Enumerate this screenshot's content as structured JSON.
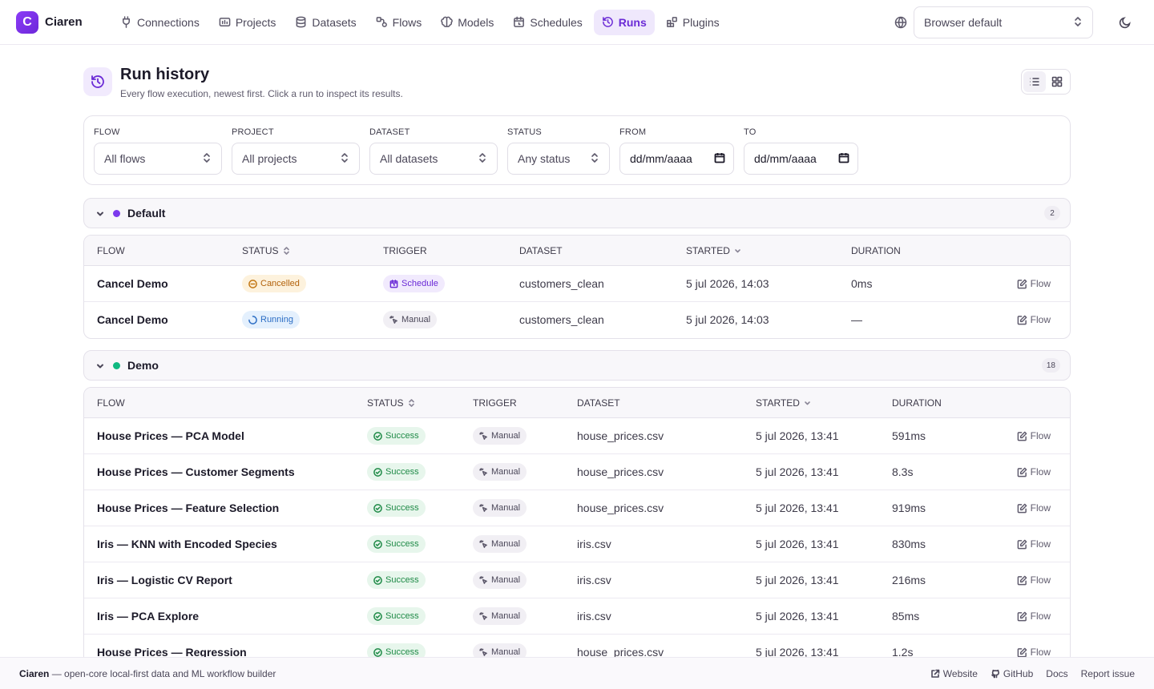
{
  "brand": {
    "logo_letter": "C",
    "name": "Ciaren"
  },
  "nav": [
    {
      "label": "Connections",
      "icon": "plug-icon"
    },
    {
      "label": "Projects",
      "icon": "folder-icon"
    },
    {
      "label": "Datasets",
      "icon": "database-icon"
    },
    {
      "label": "Flows",
      "icon": "flow-icon"
    },
    {
      "label": "Models",
      "icon": "brain-icon"
    },
    {
      "label": "Schedules",
      "icon": "calendar-icon"
    },
    {
      "label": "Runs",
      "icon": "history-icon",
      "active": true
    },
    {
      "label": "Plugins",
      "icon": "blocks-icon"
    }
  ],
  "language_select": {
    "value": "Browser default"
  },
  "header": {
    "title": "Run history",
    "subtitle": "Every flow execution, newest first. Click a run to inspect its results."
  },
  "filters": {
    "flow": {
      "label": "Flow",
      "value": "All flows"
    },
    "project": {
      "label": "Project",
      "value": "All projects"
    },
    "dataset": {
      "label": "Dataset",
      "value": "All datasets"
    },
    "status": {
      "label": "Status",
      "value": "Any status"
    },
    "from": {
      "label": "From",
      "value": "dd/mm/aaaa"
    },
    "to": {
      "label": "To",
      "value": "dd/mm/aaaa"
    }
  },
  "groups": [
    {
      "name": "Default",
      "color": "#7c3aed",
      "count": "2",
      "columns": {
        "flow": "Flow",
        "status": "Status",
        "trigger": "Trigger",
        "dataset": "Dataset",
        "started": "Started",
        "duration": "Duration"
      },
      "rows": [
        {
          "flow": "Cancel Demo",
          "status": "Cancelled",
          "trigger": "Schedule",
          "dataset": "customers_clean",
          "started": "5 jul 2026, 14:03",
          "duration": "0ms",
          "link": "Flow"
        },
        {
          "flow": "Cancel Demo",
          "status": "Running",
          "trigger": "Manual",
          "dataset": "customers_clean",
          "started": "5 jul 2026, 14:03",
          "duration": "—",
          "link": "Flow"
        }
      ]
    },
    {
      "name": "Demo",
      "color": "#10b981",
      "count": "18",
      "columns": {
        "flow": "Flow",
        "status": "Status",
        "trigger": "Trigger",
        "dataset": "Dataset",
        "started": "Started",
        "duration": "Duration"
      },
      "rows": [
        {
          "flow": "House Prices — PCA Model",
          "status": "Success",
          "trigger": "Manual",
          "dataset": "house_prices.csv",
          "started": "5 jul 2026, 13:41",
          "duration": "591ms",
          "link": "Flow"
        },
        {
          "flow": "House Prices — Customer Segments",
          "status": "Success",
          "trigger": "Manual",
          "dataset": "house_prices.csv",
          "started": "5 jul 2026, 13:41",
          "duration": "8.3s",
          "link": "Flow"
        },
        {
          "flow": "House Prices — Feature Selection",
          "status": "Success",
          "trigger": "Manual",
          "dataset": "house_prices.csv",
          "started": "5 jul 2026, 13:41",
          "duration": "919ms",
          "link": "Flow"
        },
        {
          "flow": "Iris — KNN with Encoded Species",
          "status": "Success",
          "trigger": "Manual",
          "dataset": "iris.csv",
          "started": "5 jul 2026, 13:41",
          "duration": "830ms",
          "link": "Flow"
        },
        {
          "flow": "Iris — Logistic CV Report",
          "status": "Success",
          "trigger": "Manual",
          "dataset": "iris.csv",
          "started": "5 jul 2026, 13:41",
          "duration": "216ms",
          "link": "Flow"
        },
        {
          "flow": "Iris — PCA Explore",
          "status": "Success",
          "trigger": "Manual",
          "dataset": "iris.csv",
          "started": "5 jul 2026, 13:41",
          "duration": "85ms",
          "link": "Flow"
        },
        {
          "flow": "House Prices — Regression",
          "status": "Success",
          "trigger": "Manual",
          "dataset": "house_prices.csv",
          "started": "5 jul 2026, 13:41",
          "duration": "1.2s",
          "link": "Flow"
        }
      ]
    }
  ],
  "footer": {
    "brand": "Ciaren",
    "tagline": " — open-core local-first data and ML workflow builder",
    "links": [
      "Website",
      "GitHub",
      "Docs",
      "Report issue"
    ]
  }
}
